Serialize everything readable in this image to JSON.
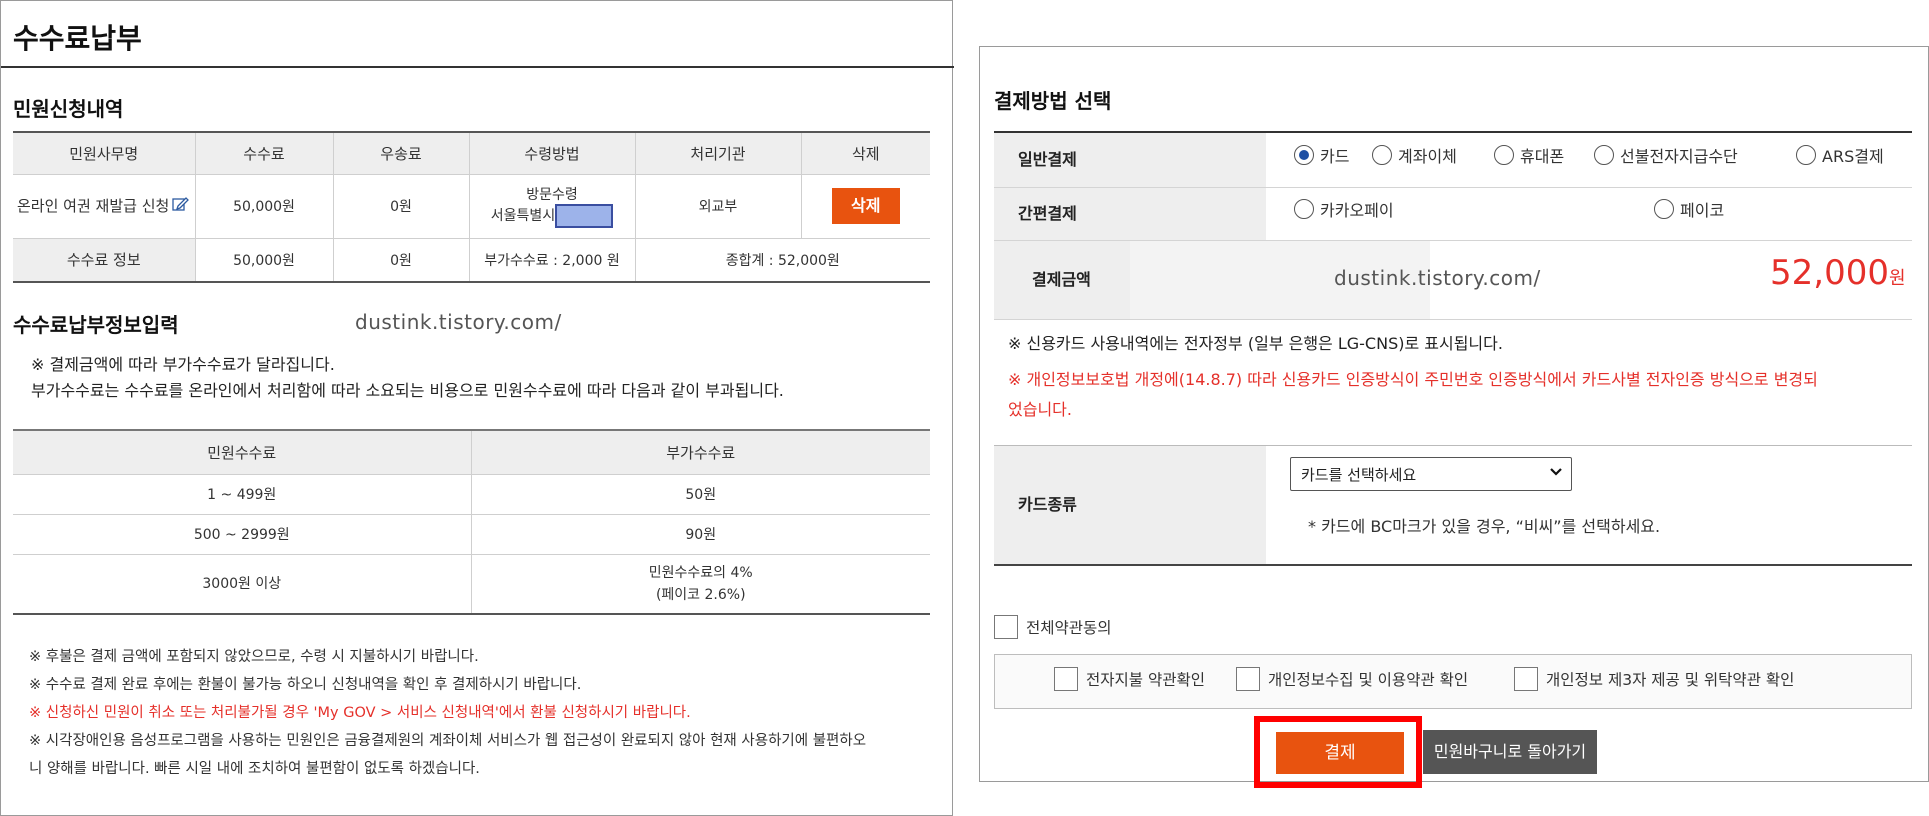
{
  "left": {
    "page_title": "수수료납부",
    "section1_title": "민원신청내역",
    "table1": {
      "headers": [
        "민원사무명",
        "수수료",
        "우송료",
        "수령방법",
        "처리기관",
        "삭제"
      ],
      "row": {
        "name": "온라인 여권 재발급 신청",
        "fee": "50,000원",
        "postage": "0원",
        "method_line1": "방문수령",
        "method_line2": "서울특별시",
        "agency": "외교부",
        "delete_label": "삭제"
      },
      "summary": {
        "label": "수수료 정보",
        "fee": "50,000원",
        "postage": "0원",
        "extra": "부가수수료 : 2,000 원",
        "total": "종합계 : 52,000원"
      }
    },
    "section2_title": "수수료납부정보입력",
    "watermark": "dustink.tistory.com/",
    "notice_line1": "※ 결제금액에 따라 부가수수료가 달라집니다.",
    "notice_line2": "부가수수료는 수수료를 온라인에서 처리함에 따라 소요되는 비용으로 민원수수료에 따라 다음과 같이 부과됩니다.",
    "table2": {
      "headers": [
        "민원수수료",
        "부가수수료"
      ],
      "rows": [
        {
          "range": "1 ~ 499원",
          "fee": "50원"
        },
        {
          "range": "500 ~ 2999원",
          "fee": "90원"
        },
        {
          "range": "3000원 이상",
          "fee": "민원수수료의 4%",
          "fee_sub": "(페이코 2.6%)"
        }
      ]
    },
    "footer_notes": {
      "n1": "※ 후불은 결제 금액에 포함되지 않았으므로, 수령 시 지불하시기 바랍니다.",
      "n2": "※ 수수료 결제 완료 후에는 환불이 불가능 하오니 신청내역을 확인 후 결제하시기 바랍니다.",
      "n3": "※ 신청하신 민원이 취소 또는 처리불가될 경우 'My GOV > 서비스 신청내역'에서 환불 신청하시기 바랍니다.",
      "n4a": "※ 시각장애인용 음성프로그램을 사용하는 민원인은 금융결제원의 계좌이체 서비스가 웹 접근성이 완료되지 않아 현재 사용하기에 불편하오",
      "n4b": "니 양해를 바랍니다. 빠른 시일 내에 조치하여 불편함이 없도록 하겠습니다."
    }
  },
  "right": {
    "title": "결제방법 선택",
    "general_label": "일반결제",
    "general_options": [
      "카드",
      "계좌이체",
      "휴대폰",
      "선불전자지급수단",
      "ARS결제"
    ],
    "general_selected": "카드",
    "simple_label": "간편결제",
    "simple_options": [
      "카카오페이",
      "페이코"
    ],
    "amount_label": "결제금액",
    "watermark": "dustink.tistory.com/",
    "amount_value": "52,000",
    "amount_unit": "원",
    "note1": "※ 신용카드 사용내역에는 전자정부 (일부 은행은 LG-CNS)로 표시됩니다.",
    "note2a": "※ 개인정보보호법 개정에(14.8.7) 따라 신용카드 인증방식이 주민번호 인증방식에서 카드사별 전자인증 방식으로 변경되",
    "note2b": "었습니다.",
    "card_type_label": "카드종류",
    "card_select_value": "카드를 선택하세요",
    "card_hint": "* 카드에 BC마크가 있을 경우, “비씨”를 선택하세요.",
    "agree_all": "전체약관동의",
    "terms": [
      "전자지불 약관확인",
      "개인정보수집 및 이용약관 확인",
      "개인정보 제3자 제공 및 위탁약관 확인"
    ],
    "pay_button": "결제",
    "back_button": "민원바구니로 돌아가기"
  },
  "colors": {
    "accent_orange": "#e8530f",
    "alert_red": "#e5302a",
    "highlight_red": "#ff0000",
    "radio_blue": "#1e4fa3"
  },
  "icons": [
    "edit-icon",
    "chevron-down-icon"
  ]
}
